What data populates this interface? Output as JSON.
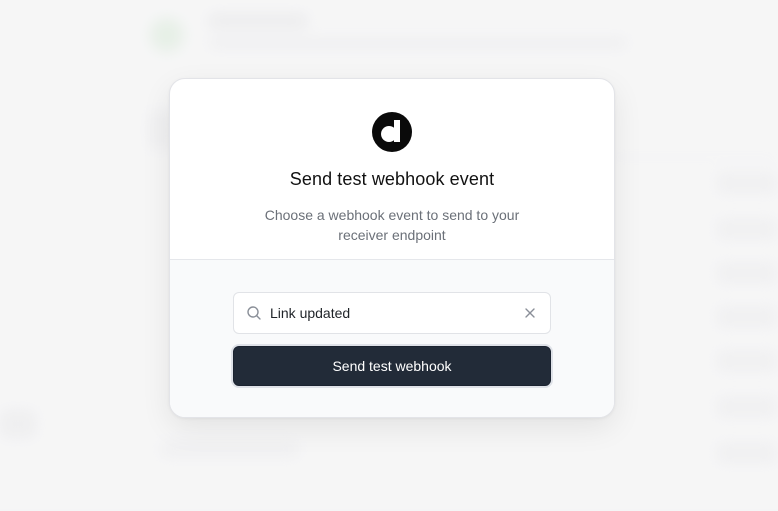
{
  "dialog": {
    "title": "Send test webhook event",
    "description": "Choose a webhook event to send to your receiver endpoint"
  },
  "search": {
    "value": "Link updated",
    "search_icon": "search-icon",
    "clear_icon": "close-icon"
  },
  "actions": {
    "send_label": "Send test webhook"
  },
  "colors": {
    "primary_button": "#222b38",
    "modal_background": "#ffffff",
    "body_background": "#f9fafb"
  },
  "logo_icon": "brand-logo-icon"
}
